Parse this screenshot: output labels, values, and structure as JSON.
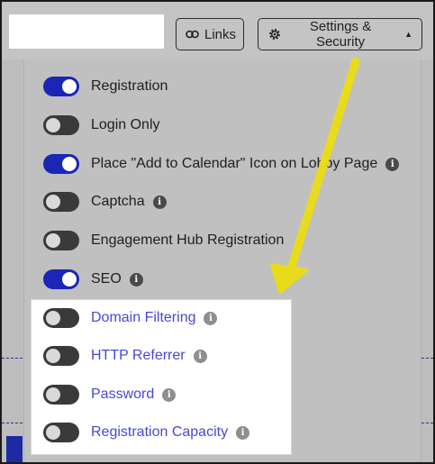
{
  "toolbar": {
    "links_label": "Links",
    "settings_label": "Settings & Security"
  },
  "options": [
    {
      "label": "Registration",
      "enabled": true,
      "info": false
    },
    {
      "label": "Login Only",
      "enabled": false,
      "info": false
    },
    {
      "label": "Place \"Add to Calendar\" Icon on Lobby Page",
      "enabled": true,
      "info": true
    },
    {
      "label": "Captcha",
      "enabled": false,
      "info": true
    },
    {
      "label": "Engagement Hub Registration",
      "enabled": false,
      "info": false
    },
    {
      "label": "SEO",
      "enabled": true,
      "info": true
    }
  ],
  "highlighted_options": [
    {
      "label": "Domain Filtering",
      "enabled": false,
      "info": true
    },
    {
      "label": "HTTP Referrer",
      "enabled": false,
      "info": true
    },
    {
      "label": "Password",
      "enabled": false,
      "info": true
    },
    {
      "label": "Registration Capacity",
      "enabled": false,
      "info": true
    }
  ],
  "colors": {
    "toggle_on": "#1a26b5",
    "toggle_off": "#3a3a3a",
    "link_text": "#4747d8",
    "arrow": "#e8dc1a"
  },
  "icons": {
    "links": "link-icon",
    "settings": "gear-icon",
    "caret": "caret-up-icon",
    "info": "info-icon"
  }
}
